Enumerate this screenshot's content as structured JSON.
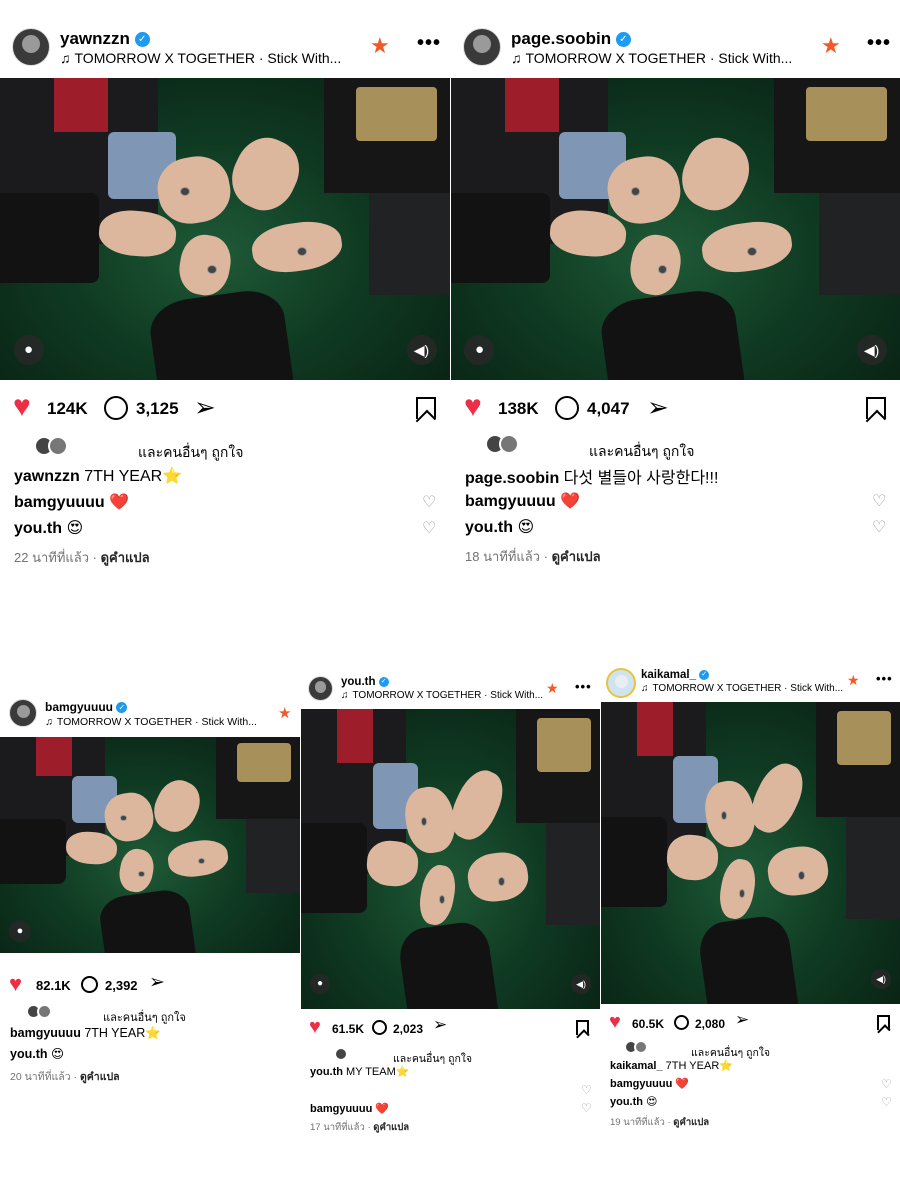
{
  "posts": [
    {
      "username": "yawnzzn",
      "music": "TOMORROW X TOGETHER · Stick With...",
      "likes": "124K",
      "comments": "3,125",
      "liked_by": "และคนอื่นๆ ถูกใจ",
      "caption_user": "yawnzzn",
      "caption_text": " 7TH YEAR⭐",
      "comment1_user": "bamgyuuuu",
      "comment1_text": " ❤️",
      "comment2_user": "you.th",
      "comment2_text": " 😍",
      "time": "22 นาทีที่แล้ว",
      "translate": "ดูคำแปล"
    },
    {
      "username": "page.soobin",
      "music": "TOMORROW X TOGETHER · Stick With...",
      "likes": "138K",
      "comments": "4,047",
      "liked_by": "และคนอื่นๆ ถูกใจ",
      "caption_user": "page.soobin",
      "caption_text": " 다섯 별들아 사랑한다!!!",
      "comment1_user": "bamgyuuuu",
      "comment1_text": " ❤️",
      "comment2_user": "you.th",
      "comment2_text": " 😍",
      "time": "18 นาทีที่แล้ว",
      "translate": "ดูคำแปล"
    },
    {
      "username": "bamgyuuuu",
      "music": "TOMORROW X TOGETHER · Stick With...",
      "likes": "82.1K",
      "comments": "2,392",
      "liked_by": "และคนอื่นๆ ถูกใจ",
      "caption_user": "bamgyuuuu",
      "caption_text": " 7TH YEAR⭐",
      "comment1_user": "you.th",
      "comment1_text": " 😍",
      "time": "20 นาทีที่แล้ว",
      "translate": "ดูคำแปล"
    },
    {
      "username": "you.th",
      "music": "TOMORROW X TOGETHER · Stick With...",
      "likes": "61.5K",
      "comments": "2,023",
      "liked_by": "และคนอื่นๆ ถูกใจ",
      "caption_user": "you.th",
      "caption_text": " MY TEAM⭐",
      "comment1_user": "bamgyuuuu",
      "comment1_text": " ❤️",
      "time": "17 นาทีที่แล้ว",
      "translate": "ดูคำแปล"
    },
    {
      "username": "kaikamal_",
      "music": "TOMORROW X TOGETHER · Stick With...",
      "likes": "60.5K",
      "comments": "2,080",
      "liked_by": "และคนอื่นๆ ถูกใจ",
      "caption_user": "kaikamal_",
      "caption_text": " 7TH YEAR⭐",
      "comment1_user": "bamgyuuuu",
      "comment1_text": " ❤️",
      "comment2_user": "you.th",
      "comment2_text": " 😍",
      "time": "19 นาทีที่แล้ว",
      "translate": "ดูคำแปล"
    }
  ],
  "icons": {
    "verified": "verified-badge-icon",
    "music": "music-note-icon",
    "star": "close-friends-star-icon",
    "more": "more-options-icon",
    "heart": "heart-icon",
    "comment": "comment-icon",
    "share": "share-icon",
    "bookmark": "bookmark-icon",
    "tag": "tagged-user-icon",
    "sound": "sound-icon"
  },
  "colors": {
    "heart": "#ed2e47",
    "verified": "#1d9bf0",
    "star": "#f05a28",
    "muted": "#737373"
  }
}
